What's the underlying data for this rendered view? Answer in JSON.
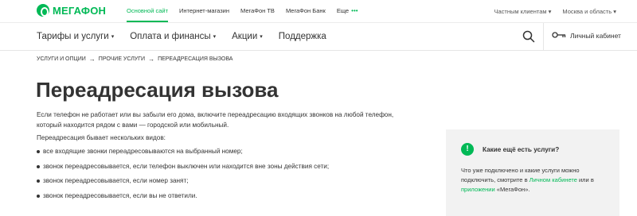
{
  "brand": {
    "name": "МЕГАФОН",
    "color": "#00b956"
  },
  "top_nav": {
    "items": [
      {
        "label": "Основной сайт",
        "active": true
      },
      {
        "label": "Интернет-магазин",
        "active": false
      },
      {
        "label": "МегаФон ТВ",
        "active": false
      },
      {
        "label": "МегаФон Банк",
        "active": false
      },
      {
        "label": "Еще",
        "active": false
      }
    ],
    "more_dots": "•••",
    "clients": "Частным клиентам",
    "region": "Москва и область",
    "caret": "▾"
  },
  "main_nav": {
    "items": [
      {
        "label": "Тарифы и услуги",
        "has_menu": true
      },
      {
        "label": "Оплата и финансы",
        "has_menu": true
      },
      {
        "label": "Акции",
        "has_menu": true
      },
      {
        "label": "Поддержка",
        "has_menu": false
      }
    ],
    "search_icon": "search-icon",
    "cabinet_label": "Личный кабинет",
    "cabinet_icon": "key-icon"
  },
  "breadcrumb": {
    "items": [
      "Услуги и опции",
      "Прочие услуги",
      "Переадресация вызова"
    ],
    "separator": "→"
  },
  "page": {
    "title": "Переадресация вызова",
    "intro": "Если телефон не работает или вы забыли его дома, включите переадресацию входящих звонков на любой телефон, который находится рядом с вами — городской или мобильный.",
    "subhead": "Переадресация бывает нескольких видов:",
    "bullets": [
      "все входящие звонки переадресовываются на выбранный номер;",
      "звонок переадресовывается, если телефон выключен или находится вне зоны действия сети;",
      "звонок переадресовывается, если номер занят;",
      "звонок переадресовывается, если вы не ответили."
    ]
  },
  "aside": {
    "icon": "exclamation-icon",
    "icon_glyph": "!",
    "heading": "Какие ещё есть услуги?",
    "text1": "Что уже подключено и какие услуги можно подключить, смотрите в ",
    "link1": "Личном кабинете",
    "text2": " или в ",
    "link2": "приложении",
    "text3": " «МегаФон»."
  }
}
